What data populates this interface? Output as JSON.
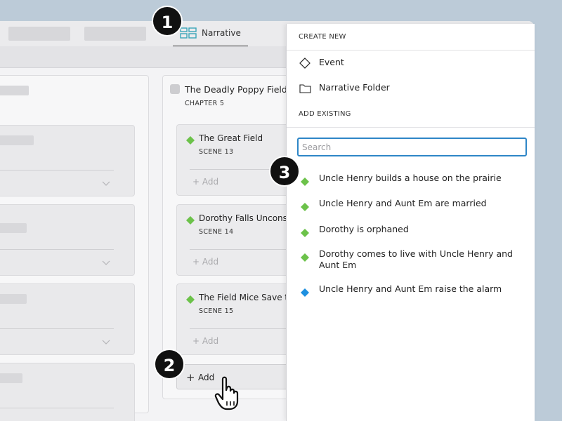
{
  "tabs": {
    "active_label": "Narrative"
  },
  "chapter": {
    "title": "The Deadly Poppy Field",
    "subtitle": "CHAPTER 5",
    "scenes": [
      {
        "title": "The Great Field",
        "subtitle": "SCENE 13",
        "add_label": "Add",
        "color": "#6cc24a"
      },
      {
        "title": "Dorothy Falls Unconscious",
        "subtitle": "SCENE 14",
        "add_label": "Add",
        "color": "#6cc24a"
      },
      {
        "title": "The Field Mice Save the Lion",
        "subtitle": "SCENE 15",
        "add_label": "Add",
        "color": "#6cc24a"
      }
    ],
    "add_label": "Add"
  },
  "dropdown": {
    "create_header": "CREATE NEW",
    "create_items": [
      {
        "label": "Event",
        "icon": "diamond-outline-icon"
      },
      {
        "label": "Narrative Folder",
        "icon": "folder-icon"
      }
    ],
    "existing_header": "ADD EXISTING",
    "search": {
      "placeholder": "Search",
      "value": ""
    },
    "results": [
      {
        "label": "Uncle Henry builds a house on the prairie",
        "color": "#6cc24a"
      },
      {
        "label": "Uncle Henry and Aunt Em are married",
        "color": "#6cc24a"
      },
      {
        "label": "Dorothy is orphaned",
        "color": "#6cc24a"
      },
      {
        "label": "Dorothy comes to live with Uncle Henry and Aunt Em",
        "color": "#6cc24a"
      },
      {
        "label": "Uncle Henry and Aunt Em raise the alarm",
        "color": "#1e90e0"
      }
    ]
  },
  "callouts": [
    "1",
    "2",
    "3"
  ]
}
